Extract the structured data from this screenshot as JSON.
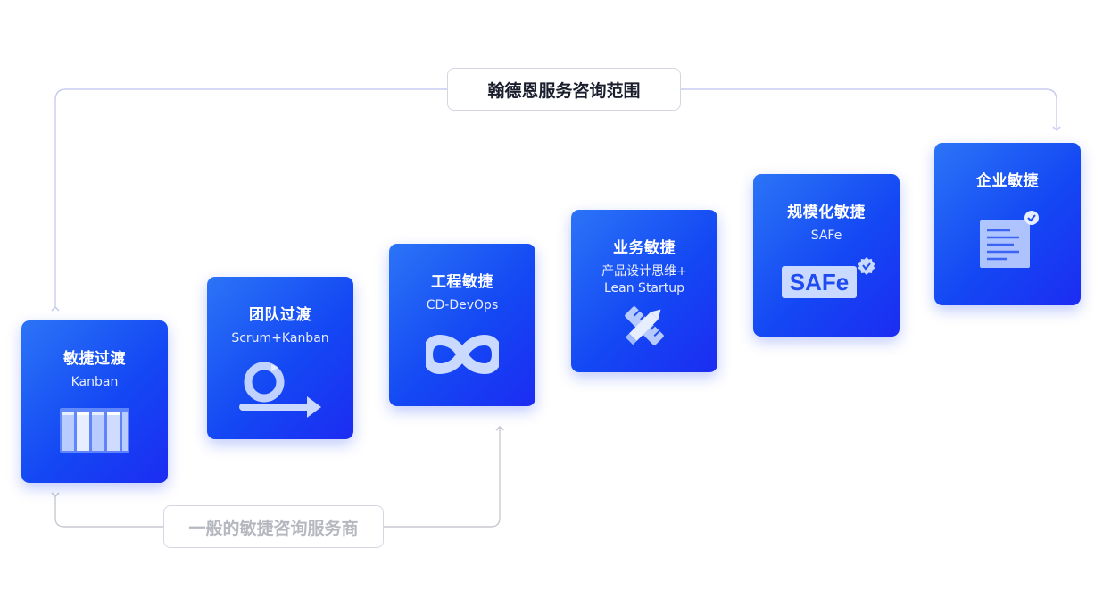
{
  "labels": {
    "scope": "翰德恩服务咨询范围",
    "general": "一般的敏捷咨询服务商"
  },
  "colors": {
    "card_gradient_start": "#2b74f6",
    "card_gradient_end": "#1c2cf2",
    "connector_top": "#c9ccf2",
    "connector_bottom": "#c8cad2",
    "icon_fill": "#c9d9ff"
  },
  "cards": [
    {
      "title": "敏捷过渡",
      "subtitle": "Kanban",
      "icon": "kanban-board-icon"
    },
    {
      "title": "团队过渡",
      "subtitle": "Scrum+Kanban",
      "icon": "scrum-cycle-icon"
    },
    {
      "title": "工程敏捷",
      "subtitle": "CD-DevOps",
      "icon": "infinity-loop-icon"
    },
    {
      "title": "业务敏捷",
      "subtitle": "产品设计思维+\nLean Startup",
      "icon": "pencil-ruler-icon"
    },
    {
      "title": "规模化敏捷",
      "subtitle": "SAFe",
      "icon": "safe-logo-icon",
      "icon_text": "SAFe"
    },
    {
      "title": "企业敏捷",
      "subtitle": "",
      "icon": "document-check-icon"
    }
  ]
}
